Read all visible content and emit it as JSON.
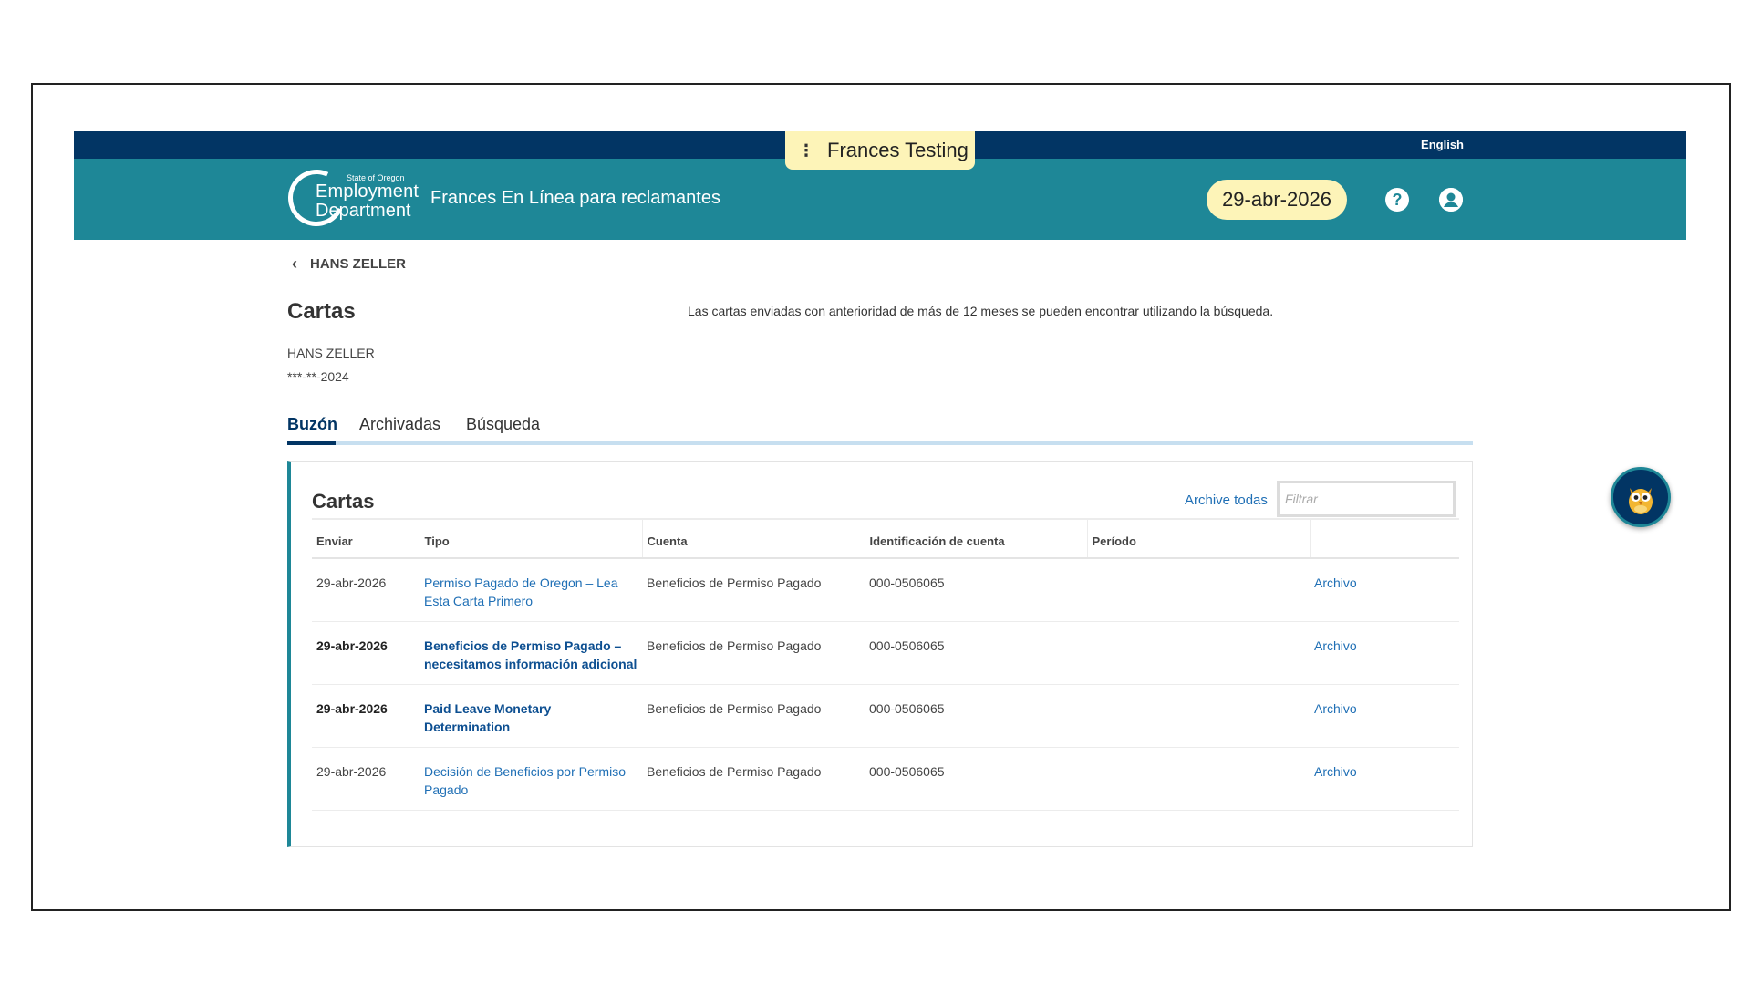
{
  "env": {
    "label": "Frances Testing"
  },
  "topbar": {
    "language_link": "English"
  },
  "header": {
    "logo_small": "State of Oregon",
    "logo_line1": "Employment",
    "logo_line2": "Department",
    "app_title": "Frances En Línea para reclamantes",
    "date": "29-abr-2026"
  },
  "breadcrumb": {
    "back_label": "HANS ZELLER"
  },
  "page": {
    "title": "Cartas",
    "notice": "Las cartas enviadas con anterioridad de más de 12 meses se pueden encontrar utilizando la búsqueda.",
    "person_name": "HANS ZELLER",
    "person_id": "***-**-2024"
  },
  "tabs": [
    {
      "label": "Buzón",
      "active": true
    },
    {
      "label": "Archivadas",
      "active": false
    },
    {
      "label": "Búsqueda",
      "active": false
    }
  ],
  "panel": {
    "title": "Cartas",
    "archive_all": "Archive todas",
    "filter_placeholder": "Filtrar",
    "columns": [
      "Enviar",
      "Tipo",
      "Cuenta",
      "Identificación de cuenta",
      "Período",
      ""
    ],
    "rows": [
      {
        "date": "29-abr-2026",
        "type": "Permiso Pagado de Oregon – Lea Esta Carta Primero",
        "account": "Beneficios de Permiso Pagado",
        "account_id": "000-0506065",
        "period": "",
        "action": "Archivo",
        "unread": false
      },
      {
        "date": "29-abr-2026",
        "type": "Beneficios de Permiso Pagado – necesitamos información adicional",
        "account": "Beneficios de Permiso Pagado",
        "account_id": "000-0506065",
        "period": "",
        "action": "Archivo",
        "unread": true
      },
      {
        "date": "29-abr-2026",
        "type": "Paid Leave Monetary Determination",
        "account": "Beneficios de Permiso Pagado",
        "account_id": "000-0506065",
        "period": "",
        "action": "Archivo",
        "unread": true
      },
      {
        "date": "29-abr-2026",
        "type": "Decisión de Beneficios por Permiso Pagado",
        "account": "Beneficios de Permiso Pagado",
        "account_id": "000-0506065",
        "period": "",
        "action": "Archivo",
        "unread": false
      }
    ]
  },
  "icons": {
    "help": "question-circle-icon",
    "user": "user-circle-icon",
    "assistant": "owl-icon"
  }
}
